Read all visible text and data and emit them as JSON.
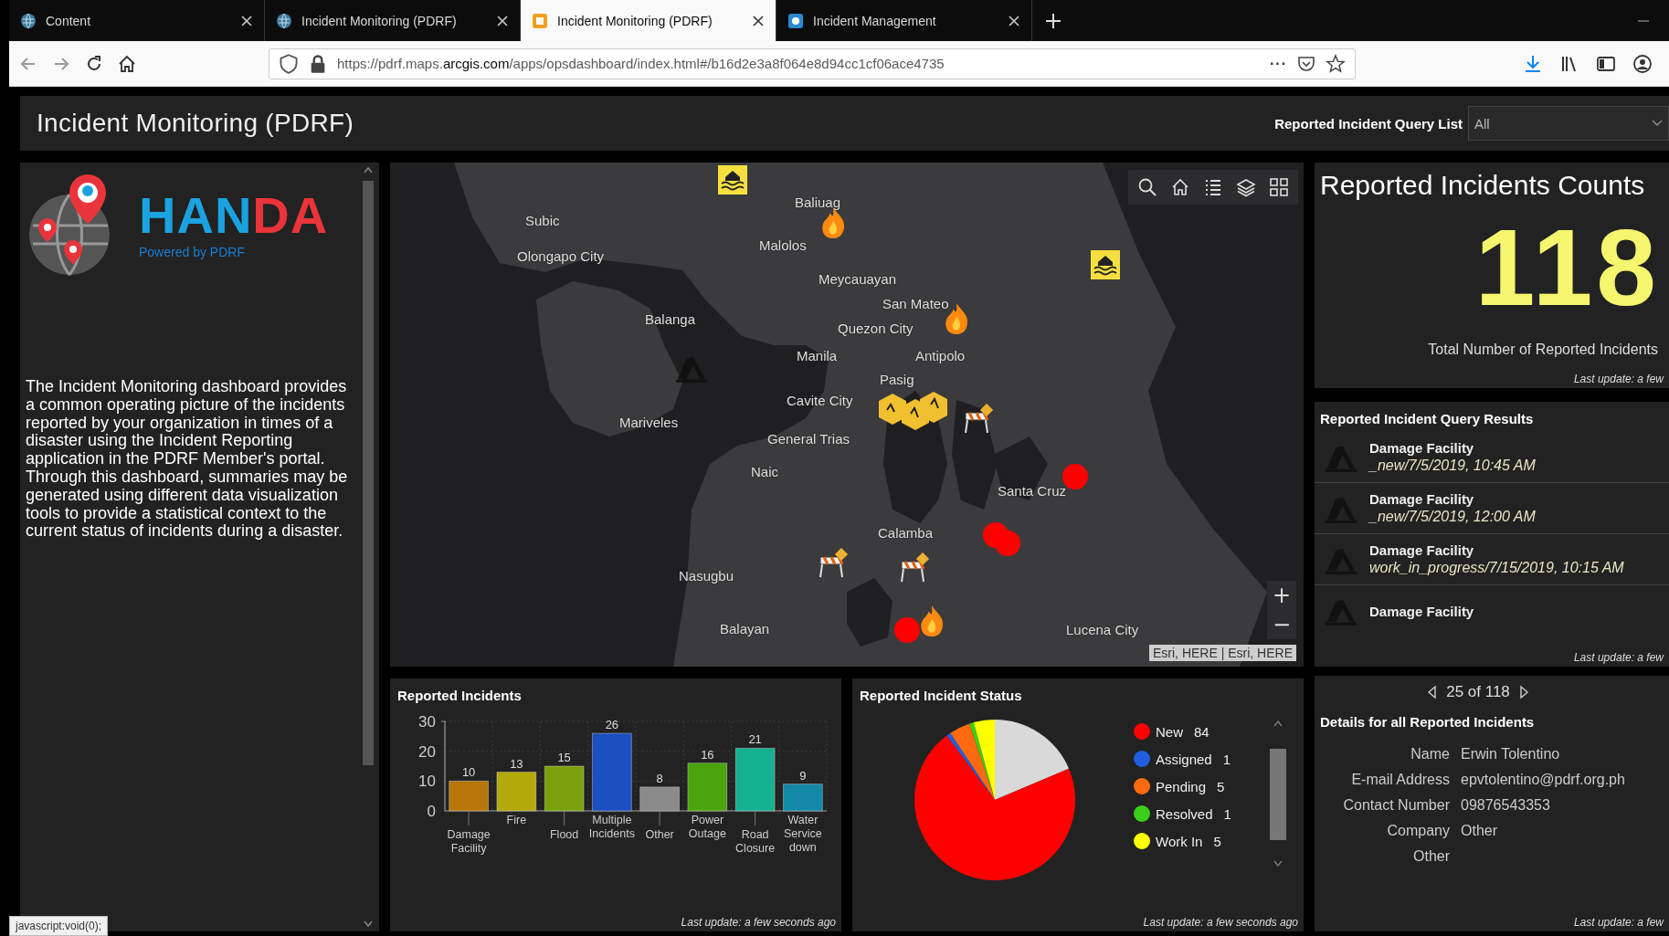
{
  "browser": {
    "tabs": [
      {
        "title": "Content",
        "selected": false
      },
      {
        "title": "Incident Monitoring (PDRF)",
        "selected": false
      },
      {
        "title": "Incident Monitoring (PDRF)",
        "selected": true
      },
      {
        "title": "Incident Management",
        "selected": false
      }
    ],
    "address": "https://pdrf.maps.**arcgis.com**/apps/opsdashboard/index.html#/b16d2e3a8f064e8d94cc1cf06ace4735",
    "more": "···"
  },
  "header": {
    "title": "Incident Monitoring (PDRF)",
    "query_label": "Reported Incident Query List",
    "query_value": "All"
  },
  "sidebar": {
    "logo_first": "HAN",
    "logo_second": "DA",
    "tagline": "Powered by PDRF",
    "description": "The Incident Monitoring dashboard provides a common operating picture of the incidents reported by your organization in times of a disaster using the Incident Reporting application in the PDRF Member's portal. Through this dashboard, summaries may be generated using different data visualization tools to provide a statistical context to the current status of incidents during a disaster."
  },
  "map": {
    "labels": [
      "Subic",
      "Olongapo City",
      "Baliuag",
      "Malolos",
      "Meycauayan",
      "San Mateo",
      "Balanga",
      "Quezon City",
      "Manila",
      "Antipolo",
      "Pasig",
      "Cavite City",
      "Mariveles",
      "General Trias",
      "Naic",
      "Santa Cruz",
      "Calamba",
      "Nasugbu",
      "Balayan",
      "Lucena City"
    ],
    "zoom_in": "+",
    "zoom_out": "−",
    "attribution": "Esri, HERE | Esri, HERE"
  },
  "bar_panel": {
    "title": "Reported Incidents",
    "updated": "Last update: a few seconds ago",
    "chart_data": {
      "type": "bar",
      "categories": [
        "Damage Facility",
        "Fire",
        "Flood",
        "Multiple Incidents",
        "Other",
        "Power Outage",
        "Road Closure",
        "Water Service down"
      ],
      "values": [
        10,
        13,
        15,
        26,
        8,
        16,
        21,
        9
      ],
      "colors": [
        "#b8760a",
        "#b4a90a",
        "#7aa10c",
        "#1c4fc0",
        "#8a8a8a",
        "#4ba30e",
        "#14b090",
        "#1488a8"
      ],
      "yticks": [
        0,
        10,
        20,
        30
      ],
      "ylim": [
        0,
        30
      ],
      "data_labels": true
    }
  },
  "status_panel": {
    "title": "Reported Incident Status",
    "updated": "Last update: a few seconds ago",
    "legend": [
      {
        "label": "New",
        "count": "84",
        "color": "#ff0000"
      },
      {
        "label": "Assigned",
        "count": "1",
        "color": "#1f5fe0"
      },
      {
        "label": "Pending",
        "count": "5",
        "color": "#ff6a10"
      },
      {
        "label": "Resolved",
        "count": "1",
        "color": "#3ad01a"
      },
      {
        "label": "Work In",
        "count": "5",
        "color": "#ffff00"
      }
    ],
    "chart_data": {
      "type": "pie",
      "values": [
        18.64,
        71.18,
        0.85,
        4.24,
        0.85,
        4.24
      ],
      "colors": [
        "#d9d9d9",
        "#ff0000",
        "#1f5fe0",
        "#ff6a10",
        "#3ad01a",
        "#ffff00"
      ]
    }
  },
  "count": {
    "title": "Reported Incidents Counts",
    "value": "118",
    "caption": "Total Number of Reported Incidents",
    "updated": "Last update: a few"
  },
  "results": {
    "title": "Reported Incident Query Results",
    "updated": "Last update: a few",
    "items": [
      {
        "title": "Damage Facility",
        "subtitle": "_new/7/5/2019, 10:45 AM"
      },
      {
        "title": "Damage Facility",
        "subtitle": "_new/7/5/2019, 12:00 AM"
      },
      {
        "title": "Damage Facility",
        "subtitle": "work_in_progress/7/15/2019, 10:15 AM"
      },
      {
        "title": "Damage Facility"
      }
    ]
  },
  "details": {
    "pager": "25 of 118",
    "title": "Details for all Reported Incidents",
    "updated": "Last update: a few",
    "fields": [
      {
        "label": "Name",
        "value": "Erwin Tolentino"
      },
      {
        "label": "E-mail Address",
        "value": "epvtolentino@pdrf.org.ph"
      },
      {
        "label": "Contact Number",
        "value": "09876543353"
      },
      {
        "label": "Company",
        "value": "Other"
      },
      {
        "label": "Other"
      }
    ]
  },
  "status_bar": "javascript:void(0);"
}
